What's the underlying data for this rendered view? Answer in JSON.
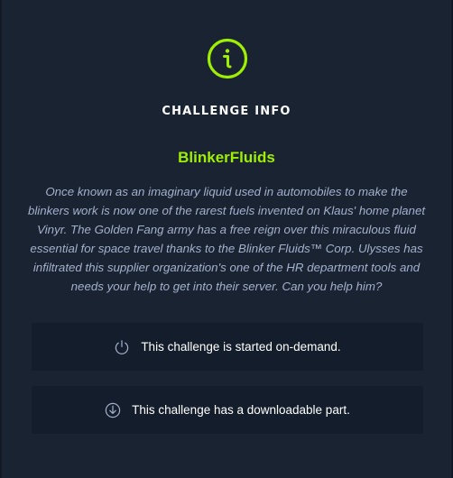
{
  "modal": {
    "icon": "info-circle-icon",
    "heading": "CHALLENGE INFO",
    "challenge_name": "BlinkerFluids",
    "description": "Once known as an imaginary liquid used in automobiles to make the blinkers work is now one of the rarest fuels invented on Klaus' home planet Vinyr. The Golden Fang army has a free reign over this miraculous fluid essential for space travel thanks to the Blinker Fluids™ Corp. Ulysses has infiltrated this supplier organization's one of the HR department tools and needs your help to get into their server. Can you help him?",
    "features": [
      {
        "icon": "power-icon",
        "label": "This challenge is started on-demand."
      },
      {
        "icon": "download-icon",
        "label": "This challenge has a downloadable part."
      }
    ]
  },
  "colors": {
    "accent": "#9fef00",
    "background": "#1a2332",
    "row_background": "#141d2b",
    "description_text": "#a4b1cd",
    "heading_text": "#ffffff"
  }
}
